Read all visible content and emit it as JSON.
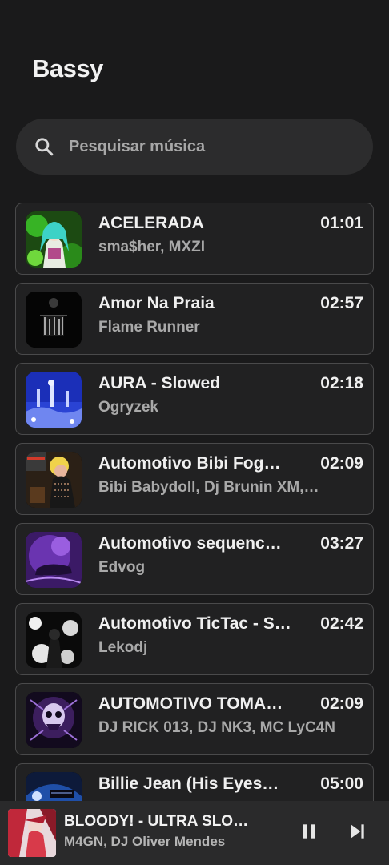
{
  "app": {
    "title": "Bassy"
  },
  "search": {
    "placeholder": "Pesquisar música",
    "icon": "search-icon"
  },
  "songs": [
    {
      "title": "ACELERADA",
      "artist": "sma$her, MXZI",
      "duration": "01:01",
      "art": "green-anime-art"
    },
    {
      "title": "Amor Na Praia",
      "artist": "Flame Runner",
      "duration": "02:57",
      "art": "dark-figure-art"
    },
    {
      "title": "AURA - Slowed",
      "artist": "Ogryzek",
      "duration": "02:18",
      "art": "blue-city-art"
    },
    {
      "title": "Automotivo Bibi Fog…",
      "artist": "Bibi Babydoll, Dj Brunin XM,…",
      "duration": "02:09",
      "art": "blonde-figure-art"
    },
    {
      "title": "Automotivo sequenc…",
      "artist": "Edvog",
      "duration": "03:27",
      "art": "purple-car-art"
    },
    {
      "title": "Automotivo TicTac - S…",
      "artist": "Lekodj",
      "duration": "02:42",
      "art": "bw-splash-art"
    },
    {
      "title": "AUTOMOTIVO TOMA…",
      "artist": "DJ RICK 013, DJ NK3, MC LyC4N",
      "duration": "02:09",
      "art": "purple-skull-art"
    },
    {
      "title": "Billie Jean (His Eyes…",
      "artist": "",
      "duration": "05:00",
      "art": "blue-mech-art"
    }
  ],
  "player": {
    "title": "BLOODY! - ULTRA SLO…",
    "artist": "M4GN, DJ Oliver Mendes",
    "pause_icon": "pause-icon",
    "next_icon": "skip-next-icon"
  }
}
